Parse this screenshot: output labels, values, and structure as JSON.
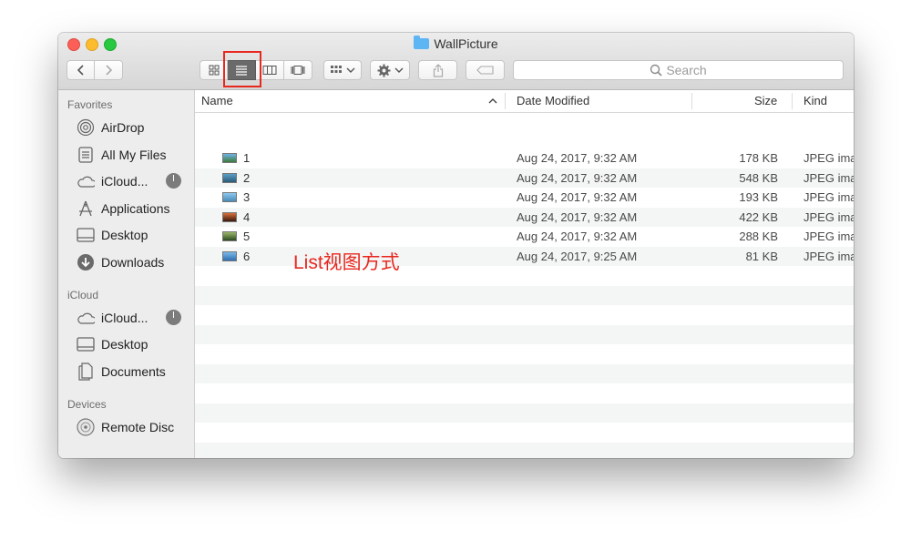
{
  "window": {
    "title": "WallPicture"
  },
  "toolbar": {
    "view_modes": [
      {
        "name": "icon-view",
        "active": false
      },
      {
        "name": "list-view",
        "active": true
      },
      {
        "name": "column-view",
        "active": false
      },
      {
        "name": "cover-flow-view",
        "active": false
      }
    ],
    "search_placeholder": "Search"
  },
  "sidebar": {
    "favorites_header": "Favorites",
    "favorites": [
      "AirDrop",
      "All My Files",
      "iCloud...",
      "Applications",
      "Desktop",
      "Downloads"
    ],
    "icloud_header": "iCloud",
    "icloud": [
      "iCloud...",
      "Desktop",
      "Documents"
    ],
    "devices_header": "Devices",
    "devices": [
      "Remote Disc"
    ]
  },
  "columns": {
    "name": "Name",
    "date": "Date Modified",
    "size": "Size",
    "kind": "Kind"
  },
  "files": [
    {
      "name": "1",
      "date": "Aug 24, 2017, 9:32 AM",
      "size": "178 KB",
      "kind": "JPEG ima"
    },
    {
      "name": "2",
      "date": "Aug 24, 2017, 9:32 AM",
      "size": "548 KB",
      "kind": "JPEG ima"
    },
    {
      "name": "3",
      "date": "Aug 24, 2017, 9:32 AM",
      "size": "193 KB",
      "kind": "JPEG ima"
    },
    {
      "name": "4",
      "date": "Aug 24, 2017, 9:32 AM",
      "size": "422 KB",
      "kind": "JPEG ima"
    },
    {
      "name": "5",
      "date": "Aug 24, 2017, 9:32 AM",
      "size": "288 KB",
      "kind": "JPEG ima"
    },
    {
      "name": "6",
      "date": "Aug 24, 2017, 9:25 AM",
      "size": "81 KB",
      "kind": "JPEG ima"
    }
  ],
  "annotation": "List视图方式",
  "colors": {
    "highlight": "#e8271f",
    "stripe": "#f4f5f5",
    "sidebar": "#ededed"
  }
}
